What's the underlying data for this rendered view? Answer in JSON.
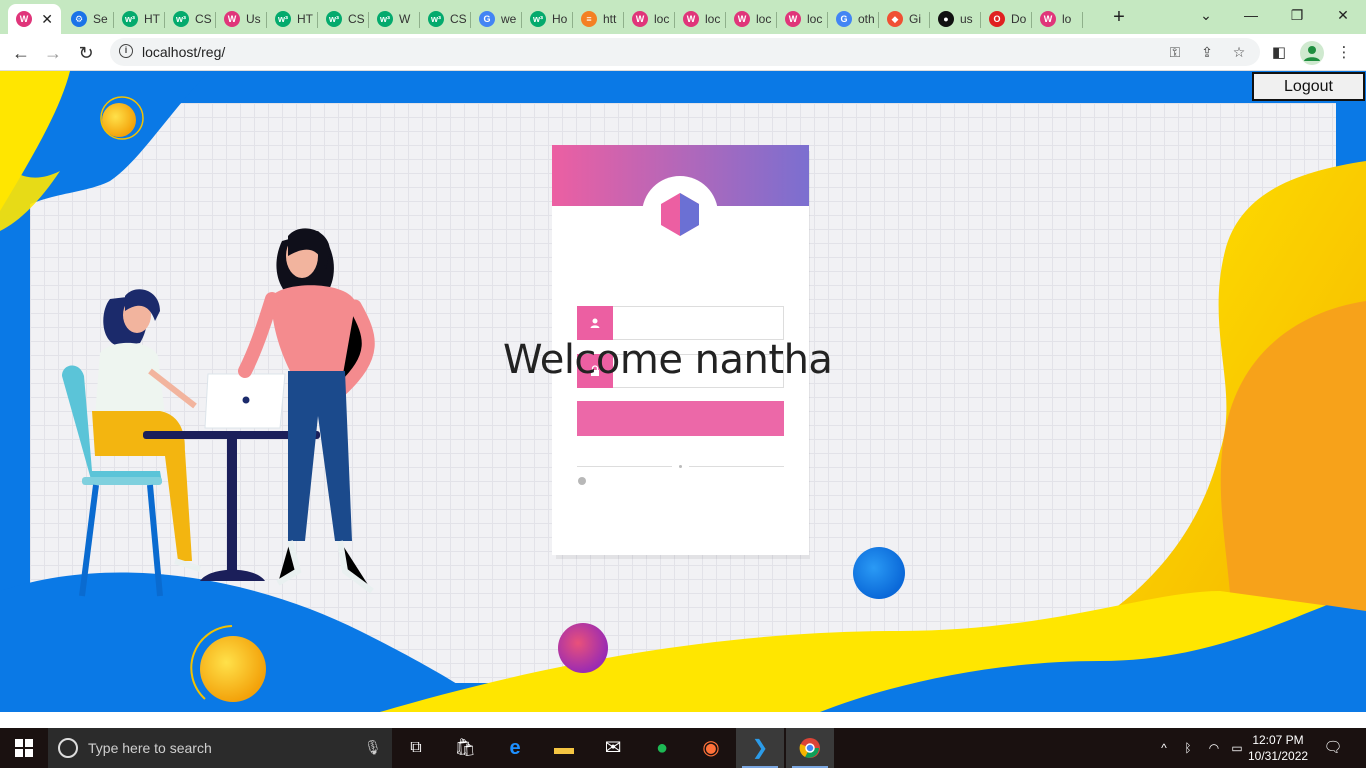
{
  "browser": {
    "tabs": [
      {
        "label": "",
        "icon": "wamp-icon",
        "color": "#e0357a",
        "active": true
      },
      {
        "label": "Se",
        "icon": "gear-icon",
        "color": "#1a73e8"
      },
      {
        "label": "HT",
        "icon": "w3-icon",
        "color": "#04aa6d"
      },
      {
        "label": "CS",
        "icon": "w3-icon",
        "color": "#04aa6d"
      },
      {
        "label": "Us",
        "icon": "wamp-icon",
        "color": "#e0357a"
      },
      {
        "label": "HT",
        "icon": "w3-icon",
        "color": "#04aa6d"
      },
      {
        "label": "CS",
        "icon": "w3-icon",
        "color": "#04aa6d"
      },
      {
        "label": "W",
        "icon": "w3-icon",
        "color": "#04aa6d"
      },
      {
        "label": "CS",
        "icon": "w3-icon",
        "color": "#04aa6d"
      },
      {
        "label": "we",
        "icon": "google-icon",
        "color": "#4285f4"
      },
      {
        "label": "Ho",
        "icon": "w3-icon",
        "color": "#04aa6d"
      },
      {
        "label": "htt",
        "icon": "stack-icon",
        "color": "#f48024"
      },
      {
        "label": "loc",
        "icon": "wamp-icon",
        "color": "#e0357a"
      },
      {
        "label": "loc",
        "icon": "wamp-icon",
        "color": "#e0357a"
      },
      {
        "label": "loc",
        "icon": "wamp-icon",
        "color": "#e0357a"
      },
      {
        "label": "loc",
        "icon": "wamp-icon",
        "color": "#e0357a"
      },
      {
        "label": "oth",
        "icon": "google-icon",
        "color": "#4285f4"
      },
      {
        "label": "Gi",
        "icon": "git-icon",
        "color": "#f05033"
      },
      {
        "label": "us",
        "icon": "github-icon",
        "color": "#111111"
      },
      {
        "label": "Do",
        "icon": "opera-icon",
        "color": "#e02020"
      },
      {
        "label": "lo",
        "icon": "wamp-icon",
        "color": "#e0357a"
      }
    ],
    "new_tab_label": "+",
    "url": "localhost/reg/"
  },
  "page": {
    "logout_label": "Logout",
    "welcome_text": "Welcome nantha"
  },
  "taskbar": {
    "search_placeholder": "Type here to search",
    "time": "12:07 PM",
    "date": "10/31/2022"
  }
}
